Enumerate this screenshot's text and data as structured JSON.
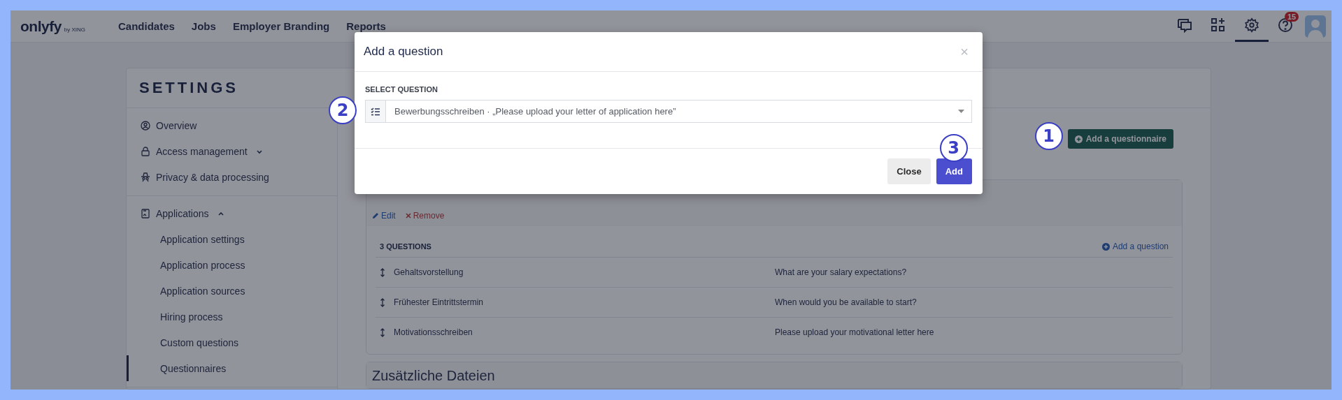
{
  "navbar": {
    "logo": "onlyfy",
    "logo_suffix": "by XING",
    "links": [
      "Candidates",
      "Jobs",
      "Employer Branding",
      "Reports"
    ],
    "icons": [
      {
        "kind": "chat",
        "selected": false
      },
      {
        "kind": "apps",
        "selected": false
      },
      {
        "kind": "settings",
        "selected": true
      },
      {
        "kind": "help",
        "selected": false,
        "badge": "15"
      }
    ]
  },
  "settings": {
    "title": "SETTINGS",
    "sidebar_groups": [
      {
        "items": [
          {
            "label": "Overview",
            "kind": "user",
            "selected": false
          },
          {
            "label": "Access management",
            "kind": "lock",
            "selected": false,
            "expanded": false
          },
          {
            "label": "Privacy & data processing",
            "kind": "privacy",
            "selected": false
          }
        ]
      },
      {
        "items": [
          {
            "label": "Applications",
            "kind": "document",
            "selected": false,
            "expanded": true,
            "children": [
              {
                "label": "Application settings",
                "selected": false
              },
              {
                "label": "Application process",
                "selected": false
              },
              {
                "label": "Application sources",
                "selected": false
              },
              {
                "label": "Hiring process",
                "selected": false
              },
              {
                "label": "Custom questions",
                "selected": false
              },
              {
                "label": "Questionnaires",
                "selected": true
              }
            ]
          }
        ]
      }
    ],
    "add_button": {
      "label": "Add a questionnaire",
      "annotation": "1"
    },
    "questionnaires": [
      {
        "edit": "Edit",
        "remove": "Remove",
        "count_label": "3 QUESTIONS",
        "add_question": "Add a question",
        "questions": [
          {
            "name": "Gehaltsvorstellung",
            "text": "What are your salary expectations?"
          },
          {
            "name": "Frühester Eintrittstermin",
            "text": "When would you be available to start?"
          },
          {
            "name": "Motivationsschreiben",
            "text": "Please upload your motivational letter here"
          }
        ]
      },
      {
        "title": "Zusätzliche Dateien"
      }
    ]
  },
  "modal": {
    "title": "Add a question",
    "close": "×",
    "label": "SELECT QUESTION",
    "select": {
      "value": "Bewerbungsschreiben · „Please upload your letter of application here”",
      "annotation": "2"
    },
    "buttons": [
      {
        "label": "Close",
        "kind": "secondary"
      },
      {
        "label": "Add",
        "kind": "primary",
        "annotation": "3"
      }
    ]
  }
}
